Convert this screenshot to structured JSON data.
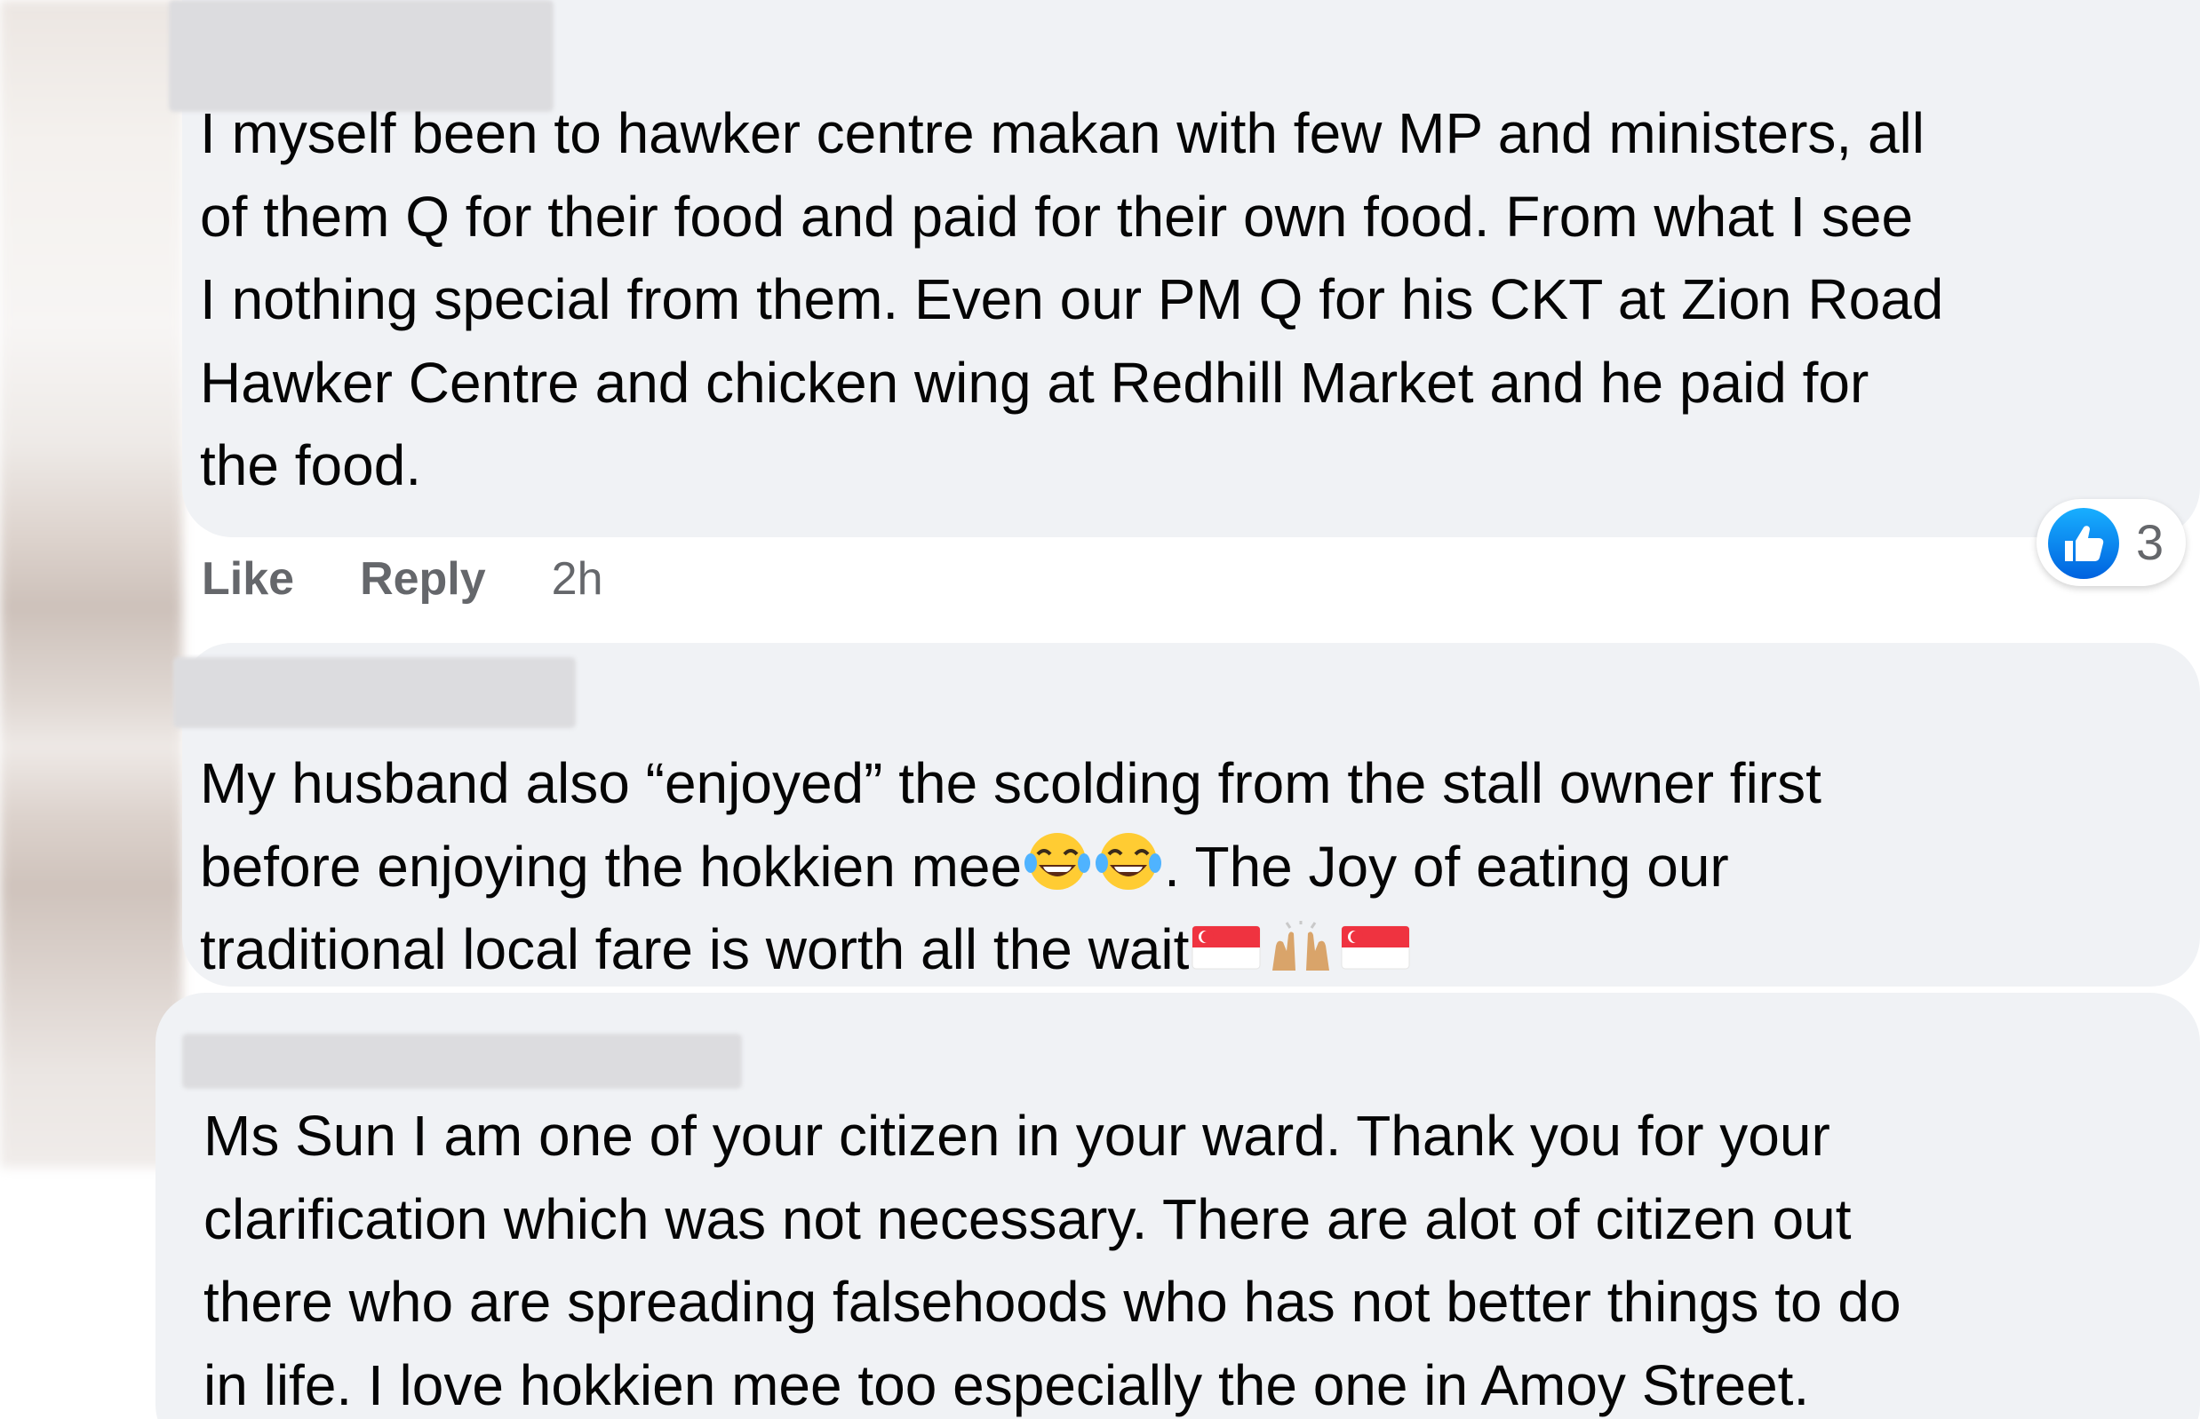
{
  "comments": [
    {
      "lines": [
        "I myself been to hawker centre makan with few MP and ministers, all",
        "of them Q for their food and paid for their own food. From what I see",
        "I nothing special from them. Even our PM Q for his CKT at Zion Road",
        "Hawker Centre and chicken wing at Redhill Market and he paid for",
        "the food."
      ],
      "actions": {
        "like_label": "Like",
        "reply_label": "Reply",
        "timestamp": "2h"
      },
      "reactions": {
        "icon": "thumbs-up-icon",
        "count": "3"
      }
    },
    {
      "lines": [
        "My husband also “enjoyed” the scolding from the stall owner first",
        "before enjoying the hokkien mee",
        ". The Joy of eating our",
        "traditional local fare is worth all the wait"
      ],
      "emojis": [
        "laughing-tears-emoji",
        "laughing-tears-emoji",
        "singapore-flag-emoji",
        "raised-hands-emoji",
        "singapore-flag-emoji"
      ]
    },
    {
      "lines": [
        "Ms Sun I am one of your citizen in your ward. Thank you for your",
        "clarification which was not necessary. There are alot of citizen out",
        "there who are spreading falsehoods who has not better things to do",
        "in life. I love hokkien mee too especially the one in Amoy Street."
      ]
    }
  ],
  "colors": {
    "bubble": "#f0f2f5",
    "text": "#050505",
    "secondary_text": "#65676b",
    "like_blue": "#1877f2"
  }
}
